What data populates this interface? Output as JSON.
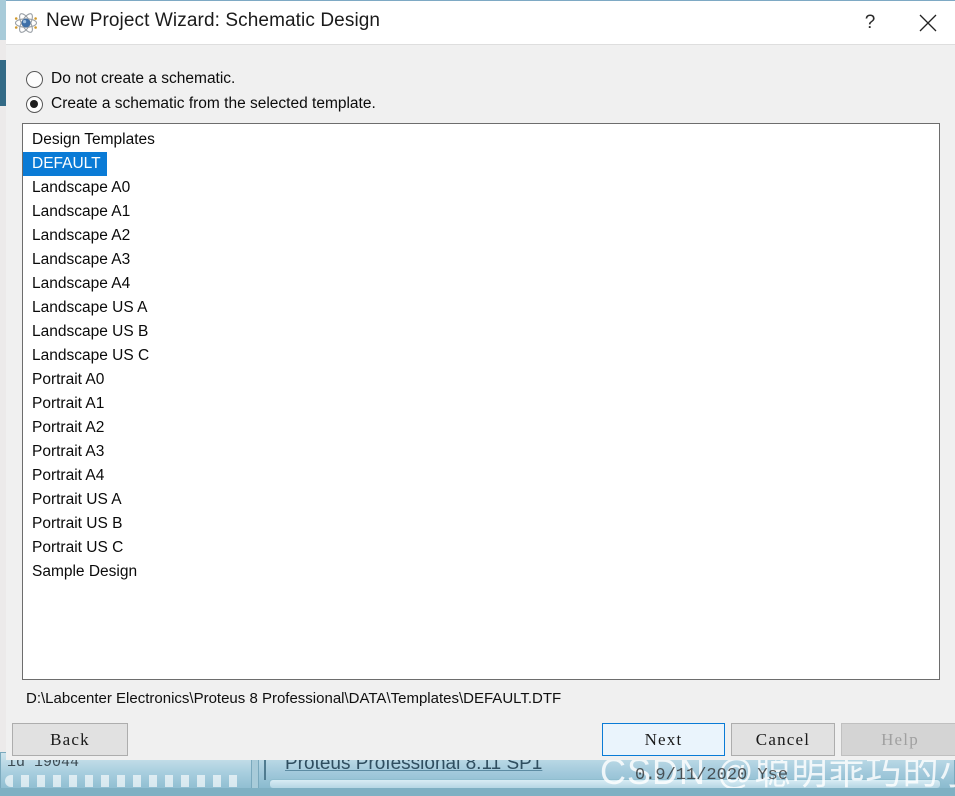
{
  "window": {
    "title": "New Project Wizard: Schematic Design",
    "icon": "proteus-atom-icon",
    "help_button": "?",
    "close_button": "close-icon",
    "accent_color": "#0a7bd6",
    "background_color": "#f0f0f0"
  },
  "options": {
    "radio_1": {
      "label": "Do not create a schematic.",
      "checked": false
    },
    "radio_2": {
      "label": "Create a schematic from the selected template.",
      "checked": true
    }
  },
  "templates": {
    "header": "Design Templates",
    "selected": "DEFAULT",
    "items": [
      "DEFAULT",
      "Landscape A0",
      "Landscape A1",
      "Landscape A2",
      "Landscape A3",
      "Landscape A4",
      "Landscape US A",
      "Landscape US B",
      "Landscape US C",
      "Portrait A0",
      "Portrait A1",
      "Portrait A2",
      "Portrait A3",
      "Portrait A4",
      "Portrait US A",
      "Portrait US B",
      "Portrait US C",
      "Sample Design"
    ]
  },
  "path": "D:\\Labcenter Electronics\\Proteus 8 Professional\\DATA\\Templates\\DEFAULT.DTF",
  "buttons": {
    "back": "Back",
    "next": "Next",
    "cancel": "Cancel",
    "help": "Help",
    "help_disabled": true,
    "next_focused": true
  },
  "background": {
    "left_window_text": "id 19044",
    "taskbar_title": "Proteus Professional 8.11 SP1",
    "watermark": "CSDN @聪明乖巧的小狮子",
    "watermark_overlap": "0.9/11/2020    Yse"
  }
}
